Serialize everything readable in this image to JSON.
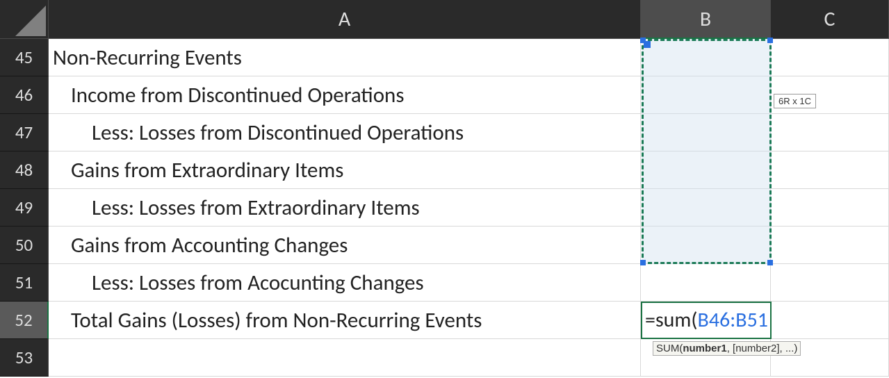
{
  "columnHeaders": {
    "A": "A",
    "B": "B",
    "C": "C"
  },
  "rows": [
    {
      "num": "45",
      "A": "Non-Recurring Events",
      "indent": 0
    },
    {
      "num": "46",
      "A": "Income from Discontinued Operations",
      "indent": 1
    },
    {
      "num": "47",
      "A": "Less: Losses from Discontinued Operations",
      "indent": 2
    },
    {
      "num": "48",
      "A": "Gains from Extraordinary Items",
      "indent": 1
    },
    {
      "num": "49",
      "A": "Less: Losses from Extraordinary Items",
      "indent": 2
    },
    {
      "num": "50",
      "A": "Gains from Accounting Changes",
      "indent": 1
    },
    {
      "num": "51",
      "A": "Less: Losses from Acocunting Changes",
      "indent": 2
    },
    {
      "num": "52",
      "A": "Total Gains (Losses) from Non-Recurring Events",
      "indent": 1
    },
    {
      "num": "53",
      "A": "",
      "indent": 0
    }
  ],
  "formula": {
    "prefix": "=sum(",
    "ref": "B46:B51"
  },
  "selectionHint": "6R x 1C",
  "tooltip": {
    "fn": "SUM(",
    "arg1": "number1",
    "rest": ", [number2], ...)"
  }
}
